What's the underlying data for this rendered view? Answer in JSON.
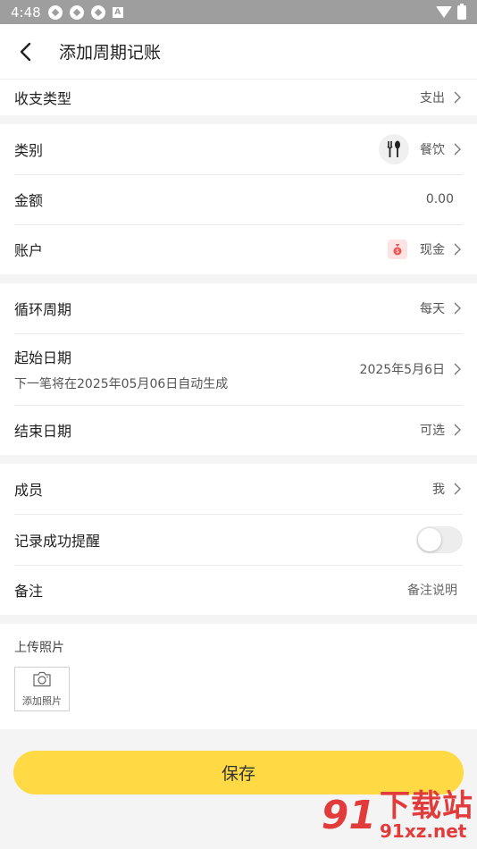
{
  "status_bar": {
    "time": "4:48",
    "a_label": "A"
  },
  "nav": {
    "title": "添加周期记账"
  },
  "sections": {
    "type": {
      "label": "收支类型",
      "value": "支出"
    },
    "category": {
      "label": "类别",
      "value": "餐饮",
      "icon": "fork-spoon-icon"
    },
    "amount": {
      "label": "金额",
      "value": "0.00"
    },
    "account": {
      "label": "账户",
      "value": "现金",
      "icon": "money-bag-icon"
    },
    "cycle": {
      "label": "循环周期",
      "value": "每天"
    },
    "start_date": {
      "label": "起始日期",
      "sub": "下一笔将在2025年05月06日自动生成",
      "value": "2025年5月6日"
    },
    "end_date": {
      "label": "结束日期",
      "value": "可选"
    },
    "member": {
      "label": "成员",
      "value": "我"
    },
    "reminder": {
      "label": "记录成功提醒",
      "enabled": false
    },
    "note": {
      "label": "备注",
      "placeholder": "备注说明"
    }
  },
  "upload": {
    "label": "上传照片",
    "add_label": "添加照片"
  },
  "save": {
    "label": "保存"
  },
  "watermark": {
    "cn": "下载站",
    "url": "91xz.net",
    "logo": "91"
  },
  "colors": {
    "accent": "#ffda44",
    "watermark": "#e23b3b"
  }
}
